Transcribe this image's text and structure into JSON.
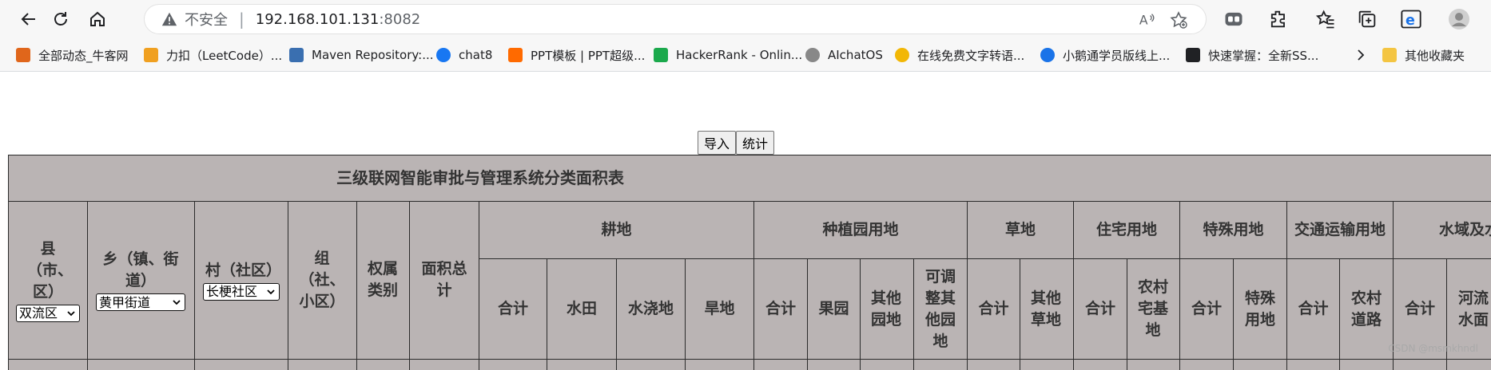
{
  "browser": {
    "insecure_label": "不安全",
    "url_host": "192.168.101.131",
    "url_port": ":8082",
    "bookmarks": [
      {
        "label": "全部动态_牛客网",
        "color": "#e0661b"
      },
      {
        "label": "力扣（LeetCode）...",
        "color": "#f0a020"
      },
      {
        "label": "Maven Repository:...",
        "color": "#3a6fb0"
      },
      {
        "label": "chat8",
        "color": "#1877f2"
      },
      {
        "label": "PPT模板 | PPT超级...",
        "color": "#ff6a00"
      },
      {
        "label": "HackerRank - Onlin...",
        "color": "#1ba94c"
      },
      {
        "label": "AIchatOS",
        "color": "#888888"
      },
      {
        "label": "在线免费文字转语...",
        "color": "#f2b705"
      },
      {
        "label": "小鹅通学员版线上...",
        "color": "#1a73e8"
      },
      {
        "label": "快速掌握：全新SS...",
        "color": "#202124"
      },
      {
        "label": "其他收藏夹",
        "color": "#f4c542"
      }
    ]
  },
  "page": {
    "import_label": "导入",
    "stats_label": "统计",
    "table_title": "三级联网智能审批与管理系统分类面积表",
    "headers": {
      "county": "县（市、区）",
      "county_value": "双流区",
      "town": "乡（镇、街道）",
      "town_value": "黄甲街道",
      "village": "村（社区）",
      "village_value": "长梗社区",
      "group": "组（社、小区）",
      "ownership": "权属类别",
      "total_area": "面积总计",
      "groups": [
        "耕地",
        "种植园用地",
        "草地",
        "住宅用地",
        "特殊用地",
        "交通运输用地",
        "水域及水"
      ],
      "subs": [
        "合计",
        "水田",
        "水浇地",
        "旱地",
        "合计",
        "果园",
        "其他园地",
        "可调整其他园地",
        "合计",
        "其他草地",
        "合计",
        "农村宅基地",
        "合计",
        "特殊用地",
        "合计",
        "农村道路",
        "合计",
        "河流水面"
      ]
    }
  },
  "watermark": "CSDN @msmkhndl"
}
